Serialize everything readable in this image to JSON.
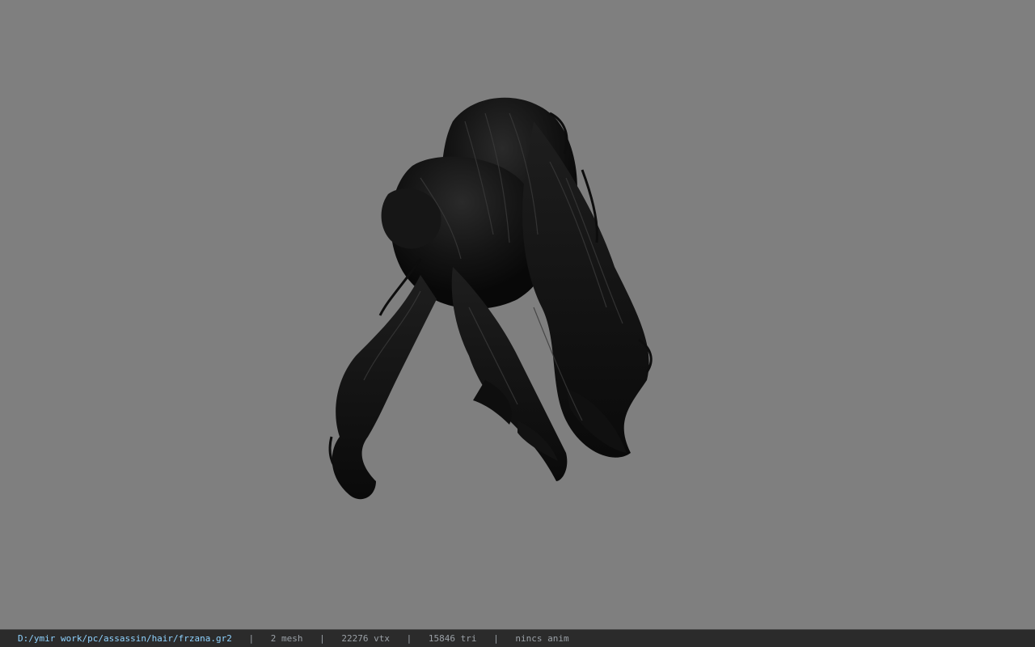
{
  "viewport": {
    "background_color": "#7f7f7f",
    "model_color": "#111111"
  },
  "statusbar": {
    "file_path": "D:/ymir work/pc/assassin/hair/frzana.gr2",
    "separator": "|",
    "mesh_count": "2 mesh",
    "vertex_count": "22276 vtx",
    "triangle_count": "15846 tri",
    "anim_info": "nincs anim",
    "path_color": "#8fd3ff"
  }
}
